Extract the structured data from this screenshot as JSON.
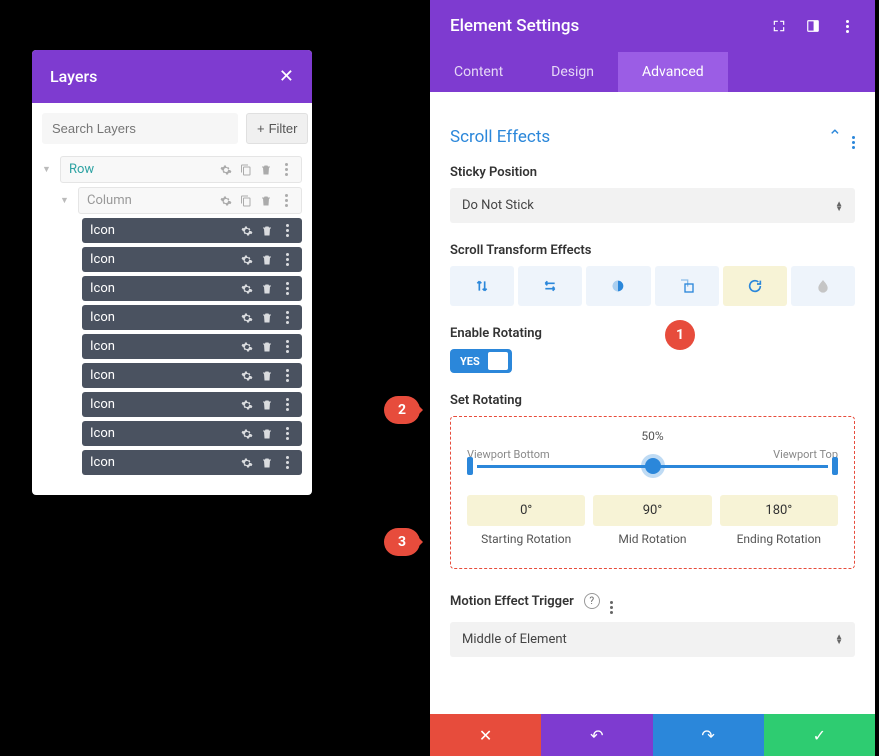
{
  "layers": {
    "title": "Layers",
    "search_placeholder": "Search Layers",
    "filter_label": "Filter",
    "row_label": "Row",
    "column_label": "Column",
    "icon_label": "Icon",
    "icon_items": [
      "Icon",
      "Icon",
      "Icon",
      "Icon",
      "Icon",
      "Icon",
      "Icon",
      "Icon",
      "Icon"
    ]
  },
  "settings": {
    "title": "Element Settings",
    "tabs": {
      "content": "Content",
      "design": "Design",
      "advanced": "Advanced"
    }
  },
  "scroll_effects": {
    "heading": "Scroll Effects",
    "sticky_position_label": "Sticky Position",
    "sticky_position_value": "Do Not Stick",
    "transform_label": "Scroll Transform Effects",
    "enable_rotating_label": "Enable Rotating",
    "enable_rotating_value": "YES",
    "set_rotating_label": "Set Rotating",
    "slider_mid_label": "50%",
    "viewport_bottom_label": "Viewport Bottom",
    "viewport_top_label": "Viewport Top",
    "rotations": {
      "start": {
        "value": "0°",
        "label": "Starting Rotation"
      },
      "mid": {
        "value": "90°",
        "label": "Mid Rotation"
      },
      "end": {
        "value": "180°",
        "label": "Ending Rotation"
      }
    },
    "motion_trigger_label": "Motion Effect Trigger",
    "motion_trigger_value": "Middle of Element"
  },
  "callouts": {
    "one": "1",
    "two": "2",
    "three": "3"
  }
}
